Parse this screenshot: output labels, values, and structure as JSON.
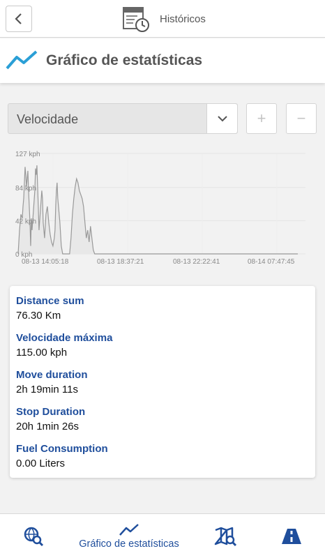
{
  "topbar": {
    "title": "Históricos",
    "back_icon": "chevron-left-icon",
    "title_icon": "calendar-clock-icon"
  },
  "header": {
    "title": "Gráfico de estatísticas",
    "icon": "line-chart-icon"
  },
  "controls": {
    "select_value": "Velocidade",
    "zoom_in_label": "+",
    "zoom_out_label": "−"
  },
  "chart_data": {
    "type": "area",
    "title": "",
    "ylabel": "",
    "xlabel": "",
    "y_ticks": [
      "127 kph",
      "84 kph",
      "42 kph",
      "0 kph"
    ],
    "x_ticks": [
      "08-13 14:05:18",
      "08-13 18:37:21",
      "08-13 22:22:41",
      "08-14 07:47:45"
    ],
    "ylim": [
      0,
      127
    ],
    "x": [
      0,
      2,
      4,
      6,
      7,
      8,
      9,
      10,
      11,
      12,
      13,
      14,
      15,
      16,
      17,
      18,
      19,
      20,
      22,
      24,
      25,
      26,
      27,
      28,
      29,
      30,
      32,
      34,
      35,
      36,
      38,
      40,
      42,
      44,
      46,
      48,
      50,
      52,
      53,
      54,
      55,
      56,
      57,
      58,
      60,
      62,
      64,
      66,
      68,
      70,
      72,
      74,
      76,
      78,
      80,
      82,
      84,
      86,
      88,
      90,
      92,
      94,
      96,
      98,
      100,
      102,
      104,
      106,
      108,
      110,
      112,
      114,
      116,
      118,
      120,
      122,
      124,
      126,
      128,
      130,
      132,
      134,
      136,
      138,
      140,
      142,
      144,
      146,
      148,
      150,
      152,
      154,
      156,
      158,
      160,
      162,
      164,
      166,
      168,
      170,
      172,
      174,
      176,
      178,
      180,
      182,
      184,
      186,
      188,
      190,
      192,
      194,
      196,
      198,
      200,
      202,
      204,
      206,
      208,
      210,
      212,
      214,
      216,
      218,
      220,
      222,
      224,
      226,
      228,
      230,
      232,
      234,
      236,
      238,
      240,
      242,
      244,
      246,
      248,
      250,
      252,
      254,
      256,
      258,
      260,
      262,
      264,
      266,
      268,
      270,
      272,
      274,
      276,
      278,
      280,
      282,
      284,
      286,
      288,
      290,
      292,
      294,
      296,
      298,
      300,
      302,
      304,
      306,
      308,
      310,
      312,
      314,
      316,
      318,
      320,
      322,
      324,
      326,
      328,
      330,
      332,
      334,
      336,
      338,
      340,
      342,
      344,
      346,
      348,
      350,
      352,
      354,
      356,
      358,
      360,
      362,
      364,
      366,
      368,
      370,
      372,
      374,
      376,
      378,
      380,
      382,
      384,
      386,
      388,
      390,
      392,
      394,
      396,
      398,
      400,
      402,
      404,
      406,
      408,
      410,
      412,
      413
    ],
    "values": [
      0,
      30,
      50,
      45,
      60,
      70,
      90,
      110,
      100,
      85,
      95,
      105,
      80,
      60,
      40,
      10,
      45,
      30,
      55,
      80,
      108,
      100,
      112,
      85,
      60,
      30,
      55,
      80,
      70,
      40,
      20,
      50,
      60,
      40,
      25,
      15,
      10,
      20,
      30,
      60,
      80,
      90,
      70,
      60,
      40,
      10,
      0,
      0,
      0,
      0,
      0,
      0,
      20,
      50,
      70,
      85,
      95,
      90,
      80,
      75,
      70,
      60,
      40,
      20,
      30,
      15,
      35,
      20,
      5,
      0,
      0,
      0,
      0,
      0,
      0,
      0,
      0,
      0,
      0,
      0,
      0,
      0,
      0,
      0,
      0,
      0,
      0,
      0,
      0,
      0,
      0,
      0,
      0,
      0,
      0,
      0,
      0,
      0,
      0,
      0,
      0,
      0,
      0,
      0,
      0,
      0,
      0,
      0,
      0,
      0,
      0,
      0,
      0,
      0,
      0,
      0,
      0,
      0,
      0,
      0,
      0,
      0,
      0,
      0,
      0,
      0,
      0,
      0,
      0,
      0,
      0,
      0,
      0,
      0,
      0,
      0,
      0,
      0,
      0,
      0,
      0,
      0,
      0,
      0,
      0,
      0,
      0,
      0,
      0,
      0,
      0,
      0,
      0,
      0,
      0,
      0,
      0,
      0,
      0,
      0,
      0,
      0,
      0,
      0,
      0,
      0,
      0,
      0,
      0,
      0,
      0,
      0,
      0,
      0,
      0,
      0,
      0,
      0,
      0,
      0,
      0,
      0,
      0,
      0,
      0,
      0,
      0,
      0,
      0,
      0,
      0,
      0,
      0,
      0,
      0,
      0,
      0,
      0,
      0,
      0,
      0,
      0,
      0,
      0,
      0,
      0,
      0,
      0,
      0,
      0,
      0,
      0,
      0,
      0,
      0,
      0
    ],
    "series_color": "#999999",
    "fill_color": "#e8e8e8",
    "grid": true
  },
  "stats": [
    {
      "label": "Distance sum",
      "value": "76.30 Km"
    },
    {
      "label": "Velocidade máxima",
      "value": "115.00 kph"
    },
    {
      "label": "Move duration",
      "value": "2h 19min 11s"
    },
    {
      "label": "Stop Duration",
      "value": "20h 1min 26s"
    },
    {
      "label": "Fuel Consumption",
      "value": "0.00 Liters"
    }
  ],
  "bottom_nav": {
    "item1_icon": "globe-search-icon",
    "item2_icon": "line-chart-icon",
    "item2_label": "Gráfico de estatísticas",
    "item3_icon": "map-search-icon",
    "item4_icon": "road-icon"
  },
  "colors": {
    "accent_blue": "#1f4e9c",
    "chart_icon_teal": "#2a9fd6"
  }
}
